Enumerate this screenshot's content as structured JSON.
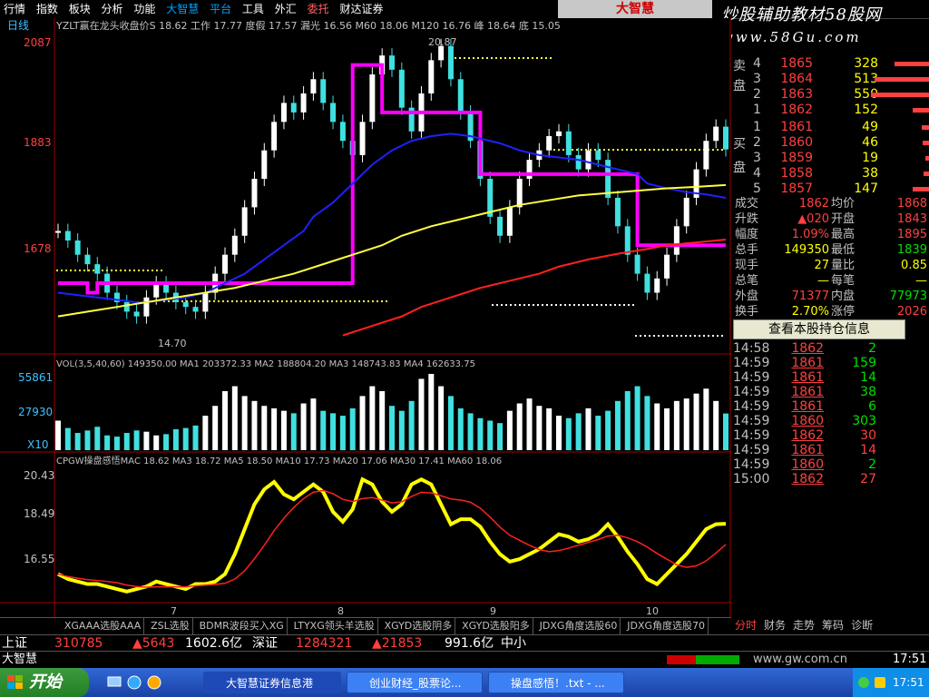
{
  "menu": {
    "items": [
      "行情",
      "指数",
      "板块",
      "分析",
      "功能",
      "大智慧",
      "平台",
      "工具",
      "外汇",
      "委托",
      "财达证券"
    ],
    "brand": "大智慧"
  },
  "watermark": {
    "line1": "炒股辅助教材58股网",
    "line2": "www.58Gu.com"
  },
  "chart": {
    "period_label": "日线",
    "header": "YZLT赢在龙头收盘价S 18.62 工作 17.77 度假 17.57 漏光 16.56 M60 18.06 M120 16.76 峰 18.64 底 15.05",
    "y_ticks_main": [
      "2087",
      "1883",
      "1678"
    ],
    "y_ticks_vol": [
      "55861",
      "27930",
      "X10"
    ],
    "y_ticks_osc": [
      "20.43",
      "18.49",
      "16.55"
    ],
    "vol_header": "VOL(3,5,40,60) 149350.00 MA1 203372.33 MA2 188804.20 MA3 148743.83 MA4 162633.75",
    "osc_header": "CPGW操盘感悟MAC 18.62 MA3 18.72 MA5 18.50 MA10 17.73 MA20 17.06 MA30 17.41 MA60 18.06",
    "x_labels": [
      "7",
      "8",
      "9",
      "10"
    ],
    "annot_high": "20.87",
    "annot_low": "14.70"
  },
  "chart_data": {
    "type": "line",
    "title": "",
    "y_range_main": [
      1450,
      2110
    ],
    "close": [
      16.9,
      16.7,
      16.4,
      16.2,
      16.0,
      15.6,
      15.4,
      15.2,
      15.1,
      15.5,
      15.8,
      15.6,
      15.4,
      15.3,
      15.2,
      15.6,
      16.0,
      16.4,
      16.8,
      17.4,
      18.0,
      18.6,
      19.2,
      19.6,
      19.4,
      19.8,
      20.1,
      19.6,
      19.2,
      18.8,
      18.5,
      19.2,
      20.2,
      20.6,
      20.3,
      19.5,
      19.0,
      19.8,
      20.5,
      20.8,
      20.1,
      19.4,
      18.8,
      18.0,
      17.2,
      16.8,
      17.4,
      18.0,
      18.4,
      18.6,
      18.9,
      19.0,
      18.5,
      18.2,
      18.6,
      18.4,
      17.6,
      17.0,
      16.4,
      16.0,
      15.6,
      15.9,
      16.4,
      17.0,
      17.6,
      18.2,
      18.8,
      19.1,
      18.62
    ],
    "ma_blue": [
      15.6,
      15.55,
      15.5,
      15.45,
      15.4,
      15.4,
      15.45,
      15.5,
      15.6,
      15.8,
      16.0,
      16.3,
      16.6,
      16.9,
      17.2,
      17.5,
      17.9,
      18.3,
      18.6,
      18.8,
      18.9,
      18.95,
      18.9,
      18.85,
      18.75,
      18.6,
      18.5,
      18.45,
      18.4,
      18.3,
      18.2,
      18.1,
      17.9,
      17.8,
      17.72,
      17.67,
      17.6
    ],
    "ma_yellow": [
      15.1,
      15.2,
      15.3,
      15.4,
      15.5,
      15.6,
      15.7,
      15.85,
      16.0,
      16.2,
      16.4,
      16.6,
      16.8,
      17.0,
      17.15,
      17.3,
      17.45,
      17.55,
      17.65,
      17.7,
      17.75,
      17.8,
      17.83,
      17.87
    ],
    "ma_red": [
      14.7,
      14.9,
      15.1,
      15.3,
      15.5,
      15.7,
      15.85,
      16.0,
      16.15,
      16.3,
      16.42,
      16.52,
      16.6,
      16.66,
      16.72
    ],
    "step_line": [
      15.8,
      15.8,
      15.8,
      15.6,
      15.8,
      15.8,
      15.8,
      15.8,
      15.8,
      15.8,
      15.8,
      15.8,
      15.8,
      15.8,
      15.8,
      15.8,
      15.8,
      15.8,
      15.8,
      15.8,
      15.8,
      15.8,
      15.8,
      15.8,
      15.8,
      15.8,
      15.8,
      15.8,
      15.8,
      15.8,
      20.4,
      20.4,
      20.4,
      19.4,
      19.4,
      19.4,
      19.4,
      19.4,
      19.4,
      19.4,
      19.4,
      19.4,
      19.4,
      18.1,
      18.1,
      18.1,
      18.1,
      18.1,
      18.1,
      18.1,
      18.1,
      18.1,
      18.1,
      18.1,
      18.1,
      18.1,
      18.1,
      18.1,
      18.1,
      16.6,
      16.6,
      16.6,
      16.6,
      16.6,
      16.6,
      16.6,
      16.6,
      16.6,
      16.6
    ],
    "volume": [
      120,
      90,
      70,
      80,
      95,
      60,
      55,
      70,
      80,
      75,
      60,
      65,
      85,
      90,
      100,
      140,
      180,
      240,
      260,
      220,
      200,
      180,
      170,
      160,
      150,
      190,
      210,
      160,
      150,
      140,
      170,
      220,
      260,
      240,
      180,
      160,
      200,
      290,
      310,
      260,
      220,
      170,
      150,
      130,
      120,
      110,
      160,
      190,
      210,
      180,
      170,
      140,
      130,
      150,
      170,
      140,
      160,
      200,
      240,
      260,
      220,
      190,
      170,
      200,
      210,
      230,
      250,
      200,
      149
    ],
    "osc": [
      16.6,
      16.4,
      16.3,
      16.2,
      16.2,
      16.1,
      16.0,
      15.9,
      16.0,
      16.1,
      16.3,
      16.2,
      16.1,
      16.0,
      16.2,
      16.2,
      16.3,
      16.6,
      17.4,
      18.4,
      19.4,
      20.0,
      20.3,
      19.8,
      19.6,
      19.9,
      20.2,
      19.9,
      19.1,
      18.7,
      19.2,
      20.4,
      20.2,
      19.5,
      19.1,
      19.4,
      20.2,
      20.4,
      20.2,
      19.4,
      18.6,
      18.8,
      18.8,
      18.5,
      17.9,
      17.4,
      17.1,
      17.2,
      17.4,
      17.6,
      17.9,
      18.2,
      18.1,
      17.9,
      18.0,
      18.2,
      18.6,
      18.1,
      17.5,
      17.0,
      16.4,
      16.2,
      16.6,
      17.0,
      17.4,
      17.9,
      18.4,
      18.6,
      18.62
    ]
  },
  "orderbook": {
    "sell_label": "卖盘",
    "buy_label": "买盘",
    "sell": [
      {
        "idx": "4",
        "price": "1865",
        "vol": "328",
        "bar": 38
      },
      {
        "idx": "3",
        "price": "1864",
        "vol": "513",
        "bar": 60
      },
      {
        "idx": "2",
        "price": "1863",
        "vol": "550",
        "bar": 64
      },
      {
        "idx": "1",
        "price": "1862",
        "vol": "152",
        "bar": 18
      }
    ],
    "buy": [
      {
        "idx": "1",
        "price": "1861",
        "vol": "49",
        "bar": 8
      },
      {
        "idx": "2",
        "price": "1860",
        "vol": "46",
        "bar": 7
      },
      {
        "idx": "3",
        "price": "1859",
        "vol": "19",
        "bar": 4
      },
      {
        "idx": "4",
        "price": "1858",
        "vol": "38",
        "bar": 6
      },
      {
        "idx": "5",
        "price": "1857",
        "vol": "147",
        "bar": 18
      }
    ]
  },
  "stats": [
    {
      "l1": "成交",
      "v1": "1862",
      "c1": "red",
      "l2": "均价",
      "v2": "1868",
      "c2": "red"
    },
    {
      "l1": "升跌",
      "v1": "▲020",
      "c1": "red",
      "l2": "开盘",
      "v2": "1843",
      "c2": "red"
    },
    {
      "l1": "幅度",
      "v1": "1.09%",
      "c1": "red",
      "l2": "最高",
      "v2": "1895",
      "c2": "red"
    },
    {
      "l1": "总手",
      "v1": "149350",
      "c1": "yellow",
      "l2": "最低",
      "v2": "1839",
      "c2": "green"
    },
    {
      "l1": "现手",
      "v1": "27",
      "c1": "yellow",
      "l2": "量比",
      "v2": "0.85",
      "c2": "yellow"
    },
    {
      "l1": "总笔",
      "v1": "—",
      "c1": "yellow",
      "l2": "每笔",
      "v2": "—",
      "c2": "yellow"
    },
    {
      "l1": "外盘",
      "v1": "71377",
      "c1": "red",
      "l2": "内盘",
      "v2": "77973",
      "c2": "green"
    },
    {
      "l1": "换手",
      "v1": "2.70%",
      "c1": "yellow",
      "l2": "涨停",
      "v2": "2026",
      "c2": "red"
    }
  ],
  "holdings_button": "查看本股持仓信息",
  "ticks": [
    {
      "time": "14:58",
      "price": "1862",
      "vol": "2",
      "pc": "red",
      "vc": "green"
    },
    {
      "time": "14:59",
      "price": "1861",
      "vol": "159",
      "pc": "red",
      "vc": "green"
    },
    {
      "time": "14:59",
      "price": "1861",
      "vol": "14",
      "pc": "red",
      "vc": "green"
    },
    {
      "time": "14:59",
      "price": "1861",
      "vol": "38",
      "pc": "red",
      "vc": "green"
    },
    {
      "time": "14:59",
      "price": "1861",
      "vol": "6",
      "pc": "red",
      "vc": "green"
    },
    {
      "time": "14:59",
      "price": "1860",
      "vol": "303",
      "pc": "red",
      "vc": "green"
    },
    {
      "time": "14:59",
      "price": "1862",
      "vol": "30",
      "pc": "red",
      "vc": "red"
    },
    {
      "time": "14:59",
      "price": "1861",
      "vol": "14",
      "pc": "red",
      "vc": "red"
    },
    {
      "time": "14:59",
      "price": "1860",
      "vol": "2",
      "pc": "red",
      "vc": "green"
    },
    {
      "time": "15:00",
      "price": "1862",
      "vol": "27",
      "pc": "red",
      "vc": "red"
    }
  ],
  "bottom_tabs": [
    "XGAAA选股AAA",
    "ZSL选股",
    "BDMR波段买入XG",
    "LTYXG领头羊选股",
    "XGYD选股阴多",
    "XGYD选股阳多",
    "JDXG角度选股60",
    "JDXG角度选股70"
  ],
  "right_tabs": [
    "分时",
    "财务",
    "走势",
    "筹码",
    "诊断"
  ],
  "status1": {
    "sh_label": "上证",
    "sh_val": "310785",
    "sh_chg": "▲5643",
    "sh_amt": "1602.6亿",
    "sz_label": "深证",
    "sz_val": "1284321",
    "sz_chg": "▲21853",
    "sz_amt": "991.6亿",
    "zx": "中小"
  },
  "status2": {
    "app": "大智慧",
    "url": "www.gw.com.cn",
    "clock": "17:51"
  },
  "taskbar": {
    "start": "开始",
    "tasks": [
      "大智慧证券信息港",
      "创业财经_股票论...",
      "操盘感悟！.txt - ..."
    ],
    "time": "17:51"
  },
  "colors": {
    "step": "#ff00ff",
    "ma_blue": "#2020ff",
    "ma_yellow": "#ffff40",
    "ma_red": "#ff2020",
    "candle_up": "#ffffff",
    "candle_dn": "#40e0e0"
  }
}
